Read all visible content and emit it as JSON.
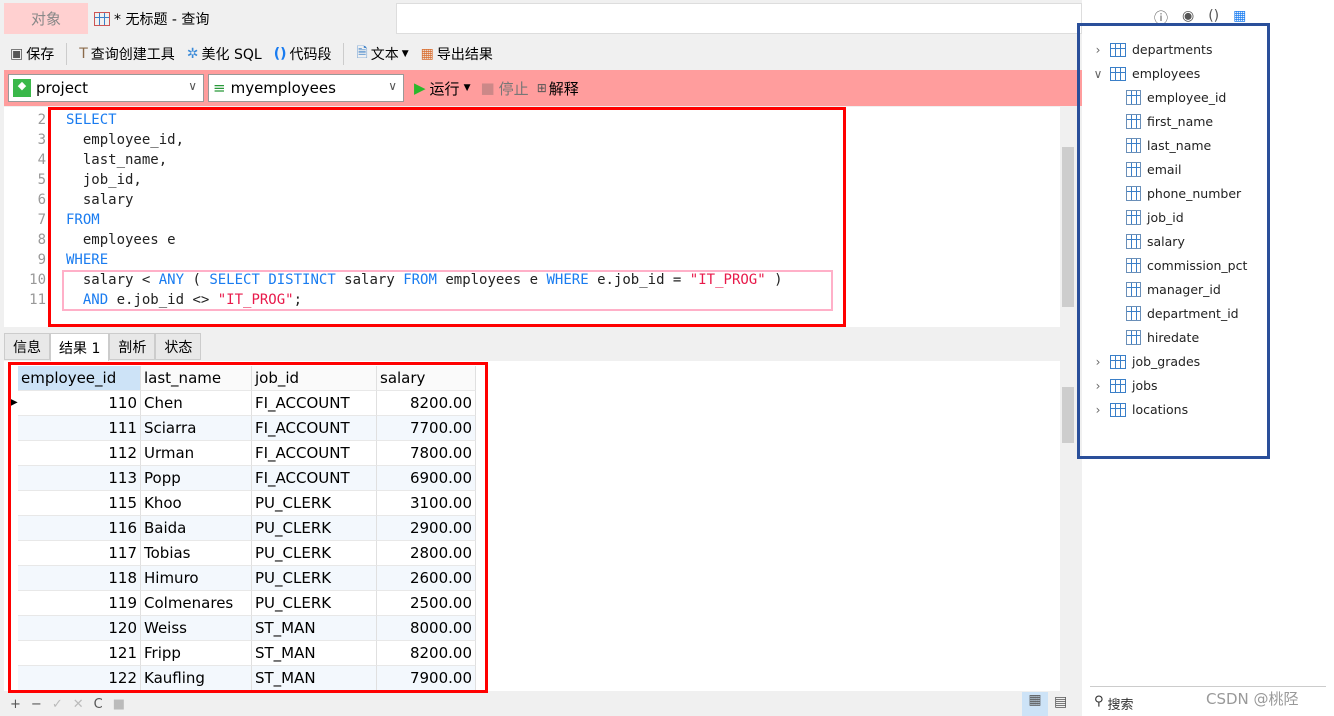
{
  "tabs": {
    "objects": "对象",
    "query": "* 无标题 - 查询"
  },
  "toolbar": {
    "save": "保存",
    "query_builder": "查询创建工具",
    "beautify": "美化 SQL",
    "snippet": "代码段",
    "text": "文本",
    "export": "导出结果"
  },
  "runbar": {
    "connection": "project",
    "database": "myemployees",
    "run": "运行",
    "stop": "停止",
    "explain": "解释"
  },
  "editor": {
    "lines": [
      {
        "n": "2",
        "tokens": [
          {
            "t": "SELECT",
            "c": "kw"
          }
        ]
      },
      {
        "n": "3",
        "tokens": [
          {
            "t": "  employee_id,",
            "c": ""
          }
        ]
      },
      {
        "n": "4",
        "tokens": [
          {
            "t": "  last_name,",
            "c": ""
          }
        ]
      },
      {
        "n": "5",
        "tokens": [
          {
            "t": "  job_id,",
            "c": ""
          }
        ]
      },
      {
        "n": "6",
        "tokens": [
          {
            "t": "  salary",
            "c": ""
          }
        ]
      },
      {
        "n": "7",
        "tokens": [
          {
            "t": "FROM",
            "c": "kw"
          }
        ]
      },
      {
        "n": "8",
        "tokens": [
          {
            "t": "  employees e",
            "c": ""
          }
        ]
      },
      {
        "n": "9",
        "tokens": [
          {
            "t": "WHERE",
            "c": "kw"
          }
        ]
      },
      {
        "n": "10",
        "tokens": [
          {
            "t": "  salary < ",
            "c": ""
          },
          {
            "t": "ANY",
            "c": "kw"
          },
          {
            "t": " ( ",
            "c": ""
          },
          {
            "t": "SELECT DISTINCT",
            "c": "kw"
          },
          {
            "t": " salary ",
            "c": ""
          },
          {
            "t": "FROM",
            "c": "kw"
          },
          {
            "t": " employees e ",
            "c": ""
          },
          {
            "t": "WHERE",
            "c": "kw"
          },
          {
            "t": " e.job_id = ",
            "c": ""
          },
          {
            "t": "\"IT_PROG\"",
            "c": "str"
          },
          {
            "t": " )",
            "c": ""
          }
        ]
      },
      {
        "n": "11",
        "tokens": [
          {
            "t": "  ",
            "c": ""
          },
          {
            "t": "AND",
            "c": "kw"
          },
          {
            "t": " e.job_id <> ",
            "c": ""
          },
          {
            "t": "\"IT_PROG\"",
            "c": "str"
          },
          {
            "t": ";",
            "c": ""
          }
        ]
      }
    ]
  },
  "result_tabs": [
    "信息",
    "结果 1",
    "剖析",
    "状态"
  ],
  "grid": {
    "columns": [
      "employee_id",
      "last_name",
      "job_id",
      "salary"
    ],
    "rows": [
      [
        "110",
        "Chen",
        "FI_ACCOUNT",
        "8200.00"
      ],
      [
        "111",
        "Sciarra",
        "FI_ACCOUNT",
        "7700.00"
      ],
      [
        "112",
        "Urman",
        "FI_ACCOUNT",
        "7800.00"
      ],
      [
        "113",
        "Popp",
        "FI_ACCOUNT",
        "6900.00"
      ],
      [
        "115",
        "Khoo",
        "PU_CLERK",
        "3100.00"
      ],
      [
        "116",
        "Baida",
        "PU_CLERK",
        "2900.00"
      ],
      [
        "117",
        "Tobias",
        "PU_CLERK",
        "2800.00"
      ],
      [
        "118",
        "Himuro",
        "PU_CLERK",
        "2600.00"
      ],
      [
        "119",
        "Colmenares",
        "PU_CLERK",
        "2500.00"
      ],
      [
        "120",
        "Weiss",
        "ST_MAN",
        "8000.00"
      ],
      [
        "121",
        "Fripp",
        "ST_MAN",
        "8200.00"
      ],
      [
        "122",
        "Kaufling",
        "ST_MAN",
        "7900.00"
      ]
    ]
  },
  "bottom_icons": [
    "+",
    "−",
    "✓",
    "✕",
    "C",
    "■"
  ],
  "tree": [
    {
      "label": "departments",
      "level": 0,
      "state": "collapsed"
    },
    {
      "label": "employees",
      "level": 0,
      "state": "expanded"
    },
    {
      "label": "employee_id",
      "level": 1
    },
    {
      "label": "first_name",
      "level": 1
    },
    {
      "label": "last_name",
      "level": 1
    },
    {
      "label": "email",
      "level": 1
    },
    {
      "label": "phone_number",
      "level": 1
    },
    {
      "label": "job_id",
      "level": 1
    },
    {
      "label": "salary",
      "level": 1
    },
    {
      "label": "commission_pct",
      "level": 1
    },
    {
      "label": "manager_id",
      "level": 1
    },
    {
      "label": "department_id",
      "level": 1
    },
    {
      "label": "hiredate",
      "level": 1
    },
    {
      "label": "job_grades",
      "level": 0,
      "state": "collapsed"
    },
    {
      "label": "jobs",
      "level": 0,
      "state": "collapsed"
    },
    {
      "label": "locations",
      "level": 0,
      "state": "collapsed"
    }
  ],
  "search": {
    "placeholder": "搜索"
  },
  "watermark": "CSDN @桃陉",
  "colors": {
    "keyword": "#1a7cf0",
    "string": "#e8194a",
    "runbar": "#ff9d9d",
    "highlight_red": "#ff0000",
    "highlight_blue": "#2a4f9a"
  }
}
